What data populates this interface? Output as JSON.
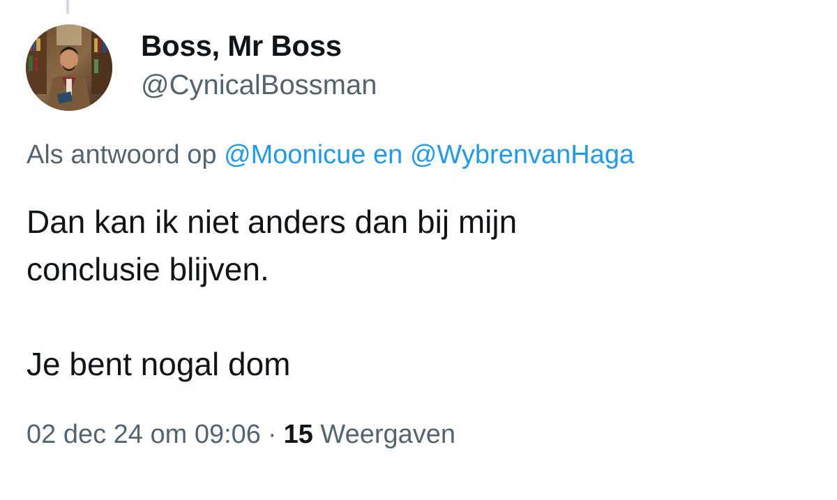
{
  "author": {
    "display_name": "Boss, Mr Boss",
    "handle": "@CynicalBossman"
  },
  "reply_to": {
    "prefix": "Als antwoord op",
    "mention_1": "@Moonicue",
    "conjunction": "en",
    "mention_2": "@WybrenvanHaga"
  },
  "tweet": {
    "line_1": "Dan kan ik niet anders dan bij mijn",
    "line_2": "conclusie blijven.",
    "line_3": "Je bent nogal dom"
  },
  "meta": {
    "timestamp": "02 dec 24 om 09:06",
    "separator": "·",
    "views_count": "15",
    "views_label": "Weergaven"
  },
  "colors": {
    "text_primary": "#0f1419",
    "text_secondary": "#536471",
    "link": "#1d9bf0"
  }
}
